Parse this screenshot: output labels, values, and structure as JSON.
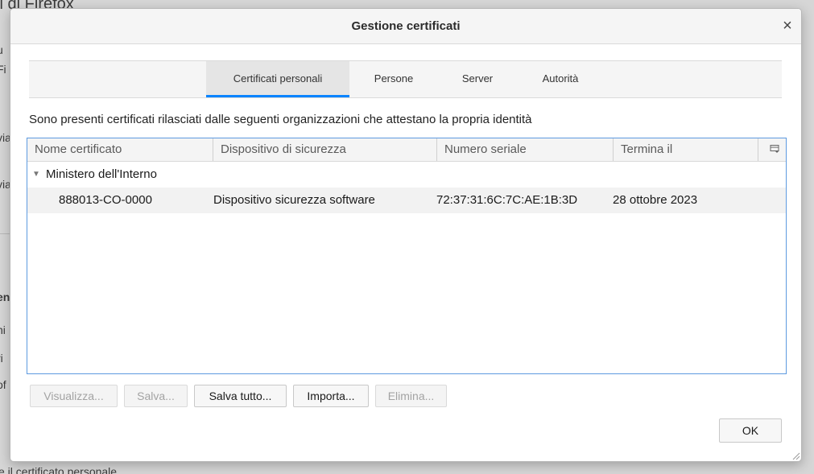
{
  "background": {
    "title_fragment": "ti di Firefox",
    "fragments": [
      "u",
      "Fi",
      "via",
      "via",
      "en",
      "hi",
      "ri",
      "of",
      "e il certificato personale"
    ]
  },
  "dialog": {
    "title": "Gestione certificati",
    "close_symbol": "×"
  },
  "tabs": [
    {
      "label": "Certificati personali",
      "active": true
    },
    {
      "label": "Persone",
      "active": false
    },
    {
      "label": "Server",
      "active": false
    },
    {
      "label": "Autorità",
      "active": false
    }
  ],
  "intro_text": "Sono presenti certificati rilasciati dalle seguenti organizzazioni che attestano la propria identità",
  "table": {
    "columns": [
      "Nome certificato",
      "Dispositivo di sicurezza",
      "Numero seriale",
      "Termina il"
    ],
    "groups": [
      {
        "name": "Ministero dell'Interno",
        "expanded": true,
        "certificates": [
          {
            "name": "888013-CO-0000",
            "device": "Dispositivo sicurezza software",
            "serial": "72:37:31:6C:7C:AE:1B:3D",
            "expires": "28 ottobre 2023"
          }
        ]
      }
    ]
  },
  "buttons": {
    "view": {
      "label": "Visualizza...",
      "enabled": false
    },
    "save": {
      "label": "Salva...",
      "enabled": false
    },
    "save_all": {
      "label": "Salva tutto...",
      "enabled": true
    },
    "import": {
      "label": "Importa...",
      "enabled": true
    },
    "delete": {
      "label": "Elimina...",
      "enabled": false
    },
    "ok": {
      "label": "OK",
      "enabled": true
    }
  },
  "colors": {
    "accent": "#0a84ff",
    "focus_border": "#5d9ae0"
  }
}
